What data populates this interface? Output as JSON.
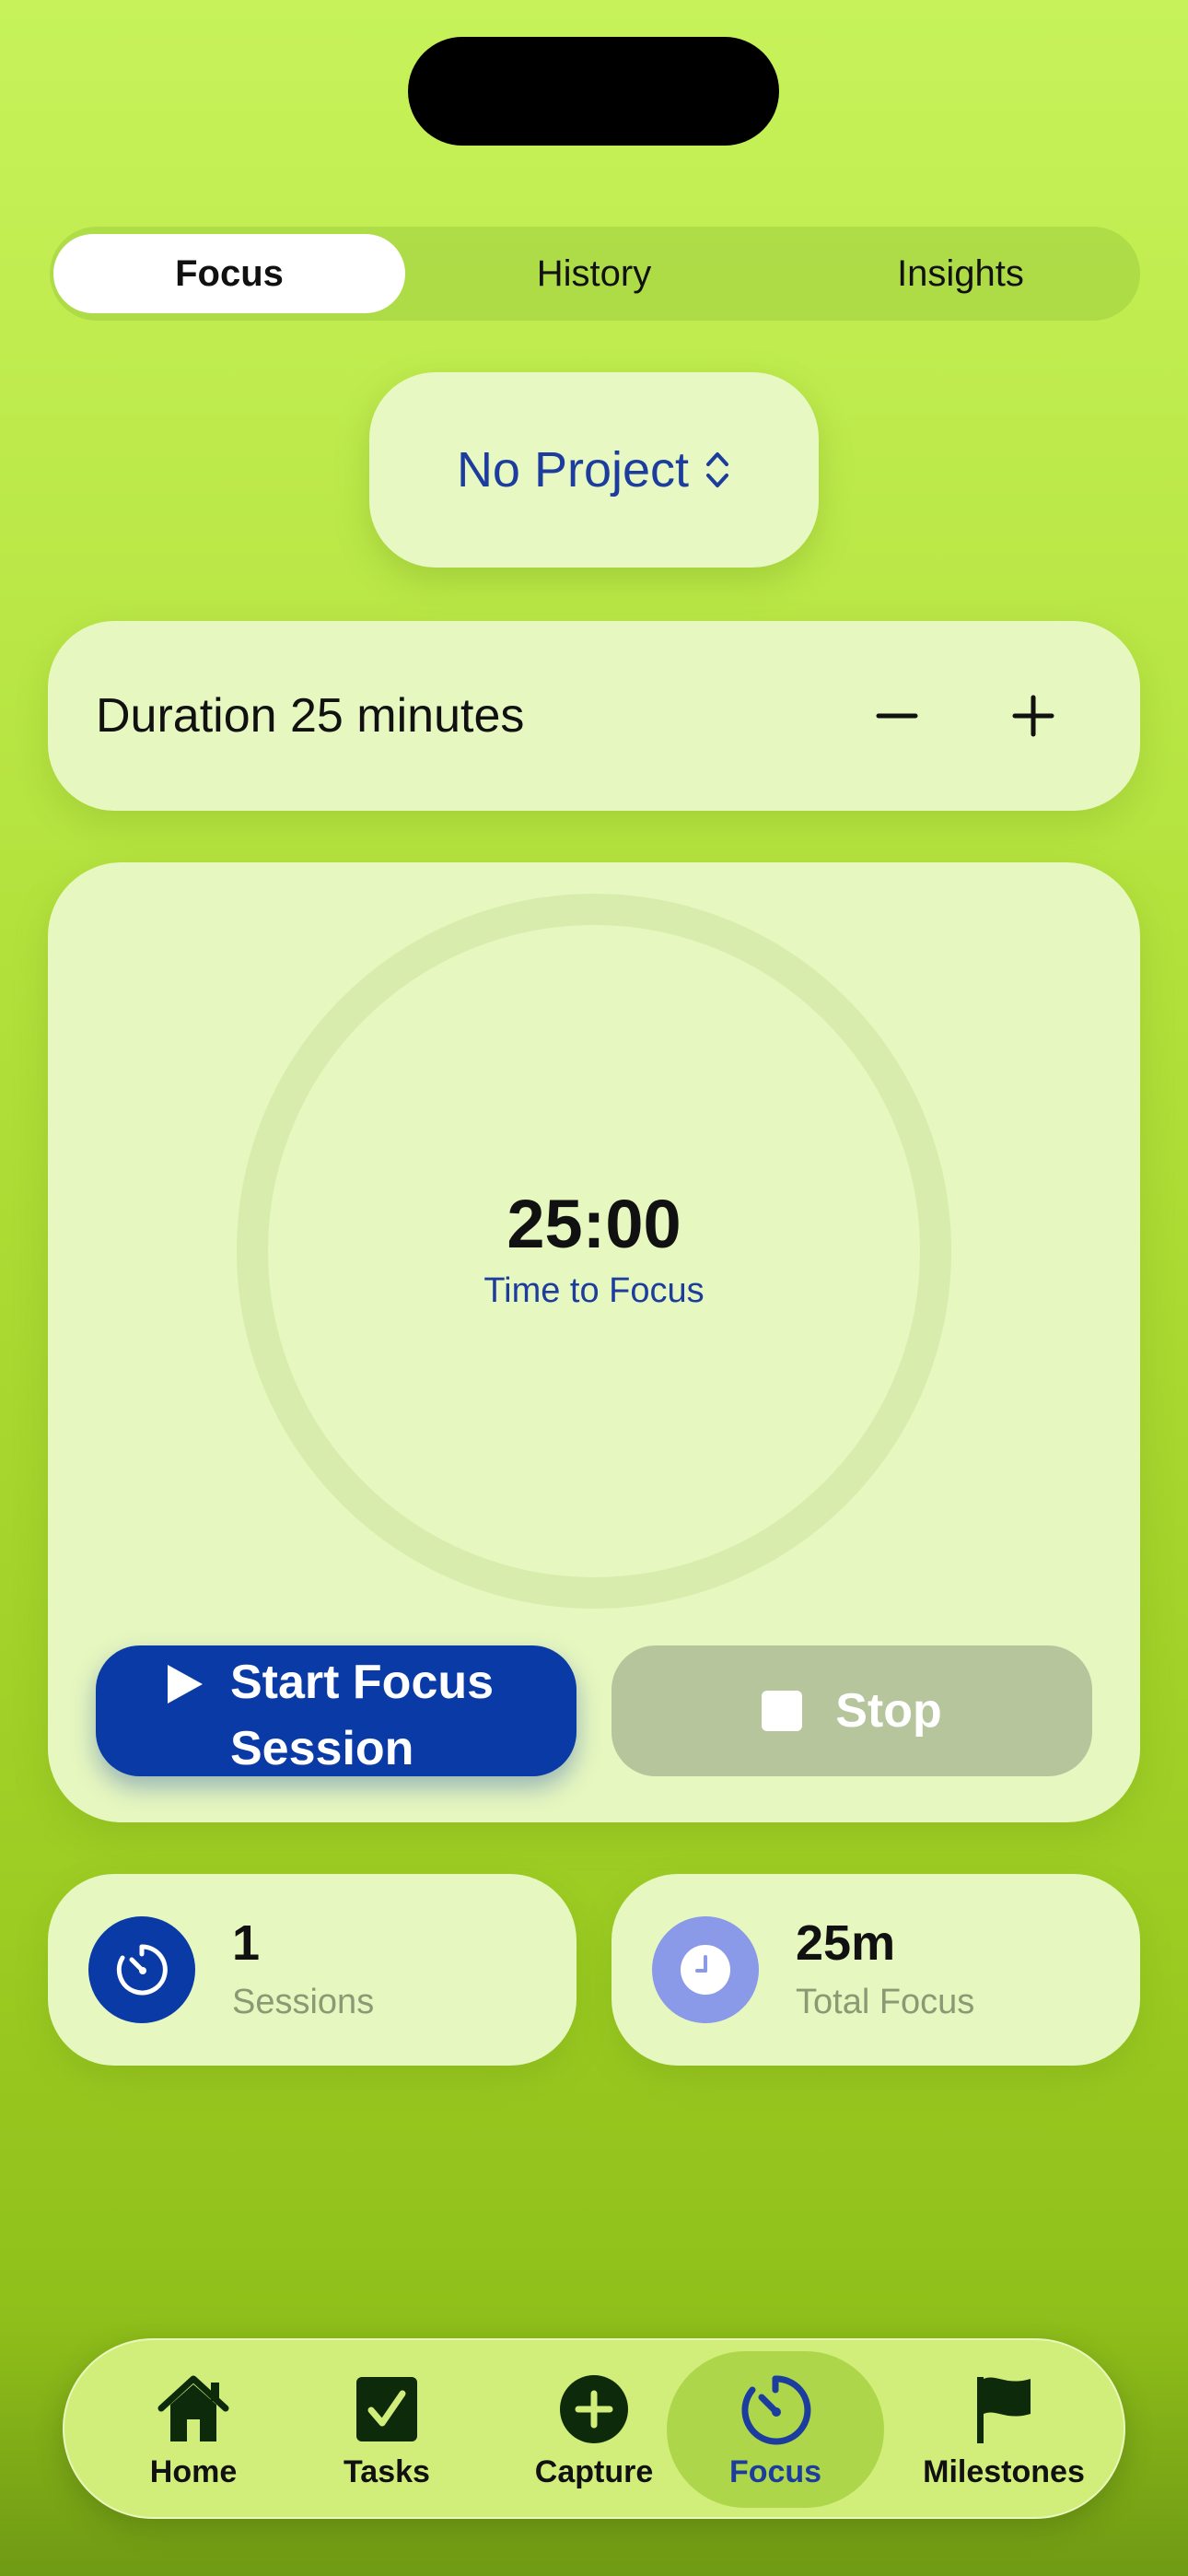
{
  "segments": [
    {
      "label": "Focus",
      "active": true
    },
    {
      "label": "History",
      "active": false
    },
    {
      "label": "Insights",
      "active": false
    }
  ],
  "project": {
    "label": "No Project",
    "icon": "chevron-up-down-icon"
  },
  "duration": {
    "label": "Duration 25 minutes",
    "minus_icon": "minus-icon",
    "plus_icon": "plus-icon"
  },
  "timer": {
    "value": "25:00",
    "caption": "Time to Focus",
    "start_label": "Start Focus Session",
    "stop_label": "Stop"
  },
  "stats": [
    {
      "value": "1",
      "label": "Sessions",
      "icon": "stopwatch-icon",
      "icon_color": "#0a3aa6"
    },
    {
      "value": "25m",
      "label": "Total Focus",
      "icon": "clock-icon",
      "icon_color": "#8b9ae8"
    }
  ],
  "tabbar": {
    "items": [
      {
        "label": "Home",
        "icon": "house-icon"
      },
      {
        "label": "Tasks",
        "icon": "checkbox-icon"
      },
      {
        "label": "Capture",
        "icon": "plus-circle-icon"
      },
      {
        "label": "Focus",
        "icon": "timer-icon",
        "active": true
      },
      {
        "label": "Milestones",
        "icon": "flag-icon"
      }
    ]
  },
  "colors": {
    "accent": "#0a3aa6",
    "link": "#1c3d9e",
    "background": "#b4e23d",
    "card": "#e6f7bf"
  }
}
